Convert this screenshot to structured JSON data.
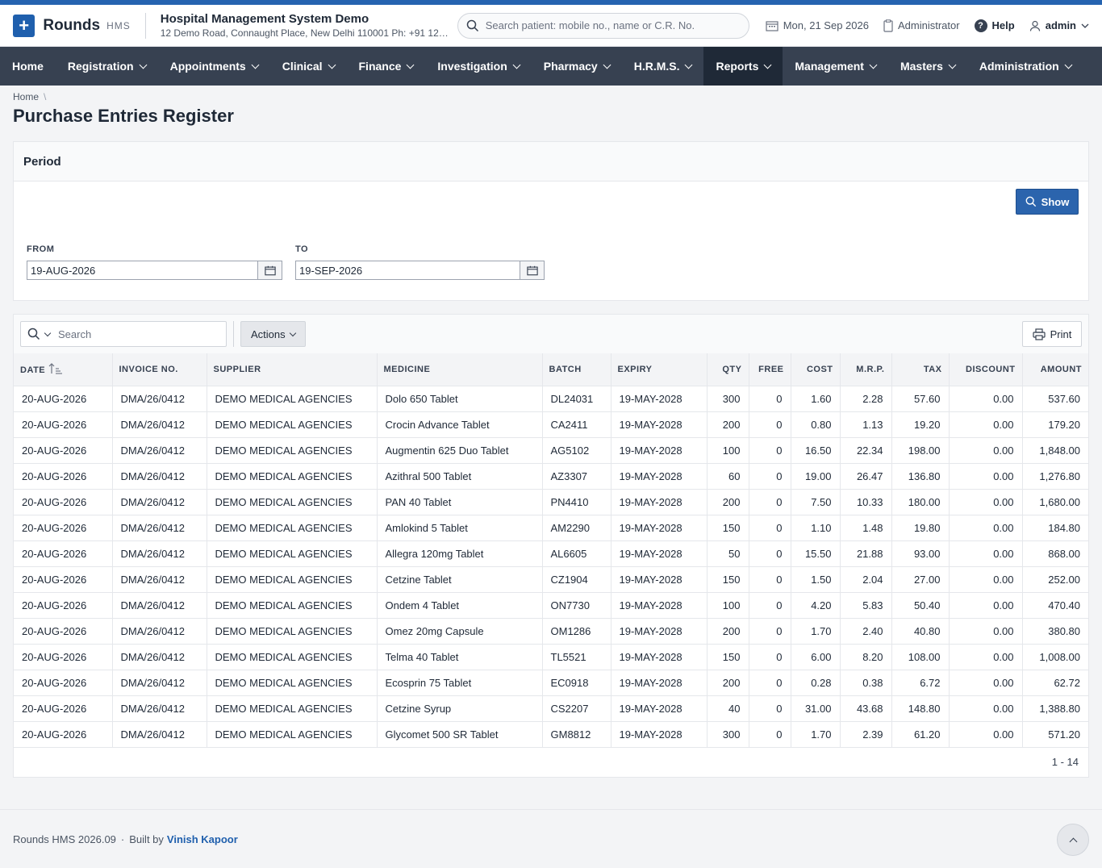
{
  "header": {
    "brand": "Rounds",
    "brand_sub": "HMS",
    "org_title": "Hospital Management System Demo",
    "org_address": "12 Demo Road, Connaught Place, New Delhi 110001 Ph: +91 123...",
    "search_placeholder": "Search patient: mobile no., name or C.R. No.",
    "date": "Mon, 21 Sep 2026",
    "role": "Administrator",
    "help": "Help",
    "user": "admin"
  },
  "nav": [
    {
      "label": "Home",
      "dropdown": false
    },
    {
      "label": "Registration",
      "dropdown": true
    },
    {
      "label": "Appointments",
      "dropdown": true
    },
    {
      "label": "Clinical",
      "dropdown": true
    },
    {
      "label": "Finance",
      "dropdown": true
    },
    {
      "label": "Investigation",
      "dropdown": true
    },
    {
      "label": "Pharmacy",
      "dropdown": true
    },
    {
      "label": "H.R.M.S.",
      "dropdown": true
    },
    {
      "label": "Reports",
      "dropdown": true,
      "active": true
    },
    {
      "label": "Management",
      "dropdown": true
    },
    {
      "label": "Masters",
      "dropdown": true
    },
    {
      "label": "Administration",
      "dropdown": true
    }
  ],
  "breadcrumb": {
    "home": "Home",
    "sep": "\\"
  },
  "page_title": "Purchase Entries Register",
  "period": {
    "title": "Period",
    "show_label": "Show",
    "from_label": "FROM",
    "from_value": "19-AUG-2026",
    "to_label": "TO",
    "to_value": "19-SEP-2026"
  },
  "toolbar": {
    "search_placeholder": "Search",
    "actions_label": "Actions",
    "print_label": "Print"
  },
  "table": {
    "columns": [
      {
        "label": "DATE",
        "num": false
      },
      {
        "label": "INVOICE NO.",
        "num": false
      },
      {
        "label": "SUPPLIER",
        "num": false
      },
      {
        "label": "MEDICINE",
        "num": false
      },
      {
        "label": "BATCH",
        "num": false
      },
      {
        "label": "EXPIRY",
        "num": false
      },
      {
        "label": "QTY",
        "num": true
      },
      {
        "label": "FREE",
        "num": true
      },
      {
        "label": "COST",
        "num": true
      },
      {
        "label": "M.R.P.",
        "num": true
      },
      {
        "label": "TAX",
        "num": true
      },
      {
        "label": "DISCOUNT",
        "num": true
      },
      {
        "label": "AMOUNT",
        "num": true
      }
    ],
    "rows": [
      [
        "20-AUG-2026",
        "DMA/26/0412",
        "DEMO MEDICAL AGENCIES",
        "Dolo 650 Tablet",
        "DL24031",
        "19-MAY-2028",
        "300",
        "0",
        "1.60",
        "2.28",
        "57.60",
        "0.00",
        "537.60"
      ],
      [
        "20-AUG-2026",
        "DMA/26/0412",
        "DEMO MEDICAL AGENCIES",
        "Crocin Advance Tablet",
        "CA2411",
        "19-MAY-2028",
        "200",
        "0",
        "0.80",
        "1.13",
        "19.20",
        "0.00",
        "179.20"
      ],
      [
        "20-AUG-2026",
        "DMA/26/0412",
        "DEMO MEDICAL AGENCIES",
        "Augmentin 625 Duo Tablet",
        "AG5102",
        "19-MAY-2028",
        "100",
        "0",
        "16.50",
        "22.34",
        "198.00",
        "0.00",
        "1,848.00"
      ],
      [
        "20-AUG-2026",
        "DMA/26/0412",
        "DEMO MEDICAL AGENCIES",
        "Azithral 500 Tablet",
        "AZ3307",
        "19-MAY-2028",
        "60",
        "0",
        "19.00",
        "26.47",
        "136.80",
        "0.00",
        "1,276.80"
      ],
      [
        "20-AUG-2026",
        "DMA/26/0412",
        "DEMO MEDICAL AGENCIES",
        "PAN 40 Tablet",
        "PN4410",
        "19-MAY-2028",
        "200",
        "0",
        "7.50",
        "10.33",
        "180.00",
        "0.00",
        "1,680.00"
      ],
      [
        "20-AUG-2026",
        "DMA/26/0412",
        "DEMO MEDICAL AGENCIES",
        "Amlokind 5 Tablet",
        "AM2290",
        "19-MAY-2028",
        "150",
        "0",
        "1.10",
        "1.48",
        "19.80",
        "0.00",
        "184.80"
      ],
      [
        "20-AUG-2026",
        "DMA/26/0412",
        "DEMO MEDICAL AGENCIES",
        "Allegra 120mg Tablet",
        "AL6605",
        "19-MAY-2028",
        "50",
        "0",
        "15.50",
        "21.88",
        "93.00",
        "0.00",
        "868.00"
      ],
      [
        "20-AUG-2026",
        "DMA/26/0412",
        "DEMO MEDICAL AGENCIES",
        "Cetzine Tablet",
        "CZ1904",
        "19-MAY-2028",
        "150",
        "0",
        "1.50",
        "2.04",
        "27.00",
        "0.00",
        "252.00"
      ],
      [
        "20-AUG-2026",
        "DMA/26/0412",
        "DEMO MEDICAL AGENCIES",
        "Ondem 4 Tablet",
        "ON7730",
        "19-MAY-2028",
        "100",
        "0",
        "4.20",
        "5.83",
        "50.40",
        "0.00",
        "470.40"
      ],
      [
        "20-AUG-2026",
        "DMA/26/0412",
        "DEMO MEDICAL AGENCIES",
        "Omez 20mg Capsule",
        "OM1286",
        "19-MAY-2028",
        "200",
        "0",
        "1.70",
        "2.40",
        "40.80",
        "0.00",
        "380.80"
      ],
      [
        "20-AUG-2026",
        "DMA/26/0412",
        "DEMO MEDICAL AGENCIES",
        "Telma 40 Tablet",
        "TL5521",
        "19-MAY-2028",
        "150",
        "0",
        "6.00",
        "8.20",
        "108.00",
        "0.00",
        "1,008.00"
      ],
      [
        "20-AUG-2026",
        "DMA/26/0412",
        "DEMO MEDICAL AGENCIES",
        "Ecosprin 75 Tablet",
        "EC0918",
        "19-MAY-2028",
        "200",
        "0",
        "0.28",
        "0.38",
        "6.72",
        "0.00",
        "62.72"
      ],
      [
        "20-AUG-2026",
        "DMA/26/0412",
        "DEMO MEDICAL AGENCIES",
        "Cetzine Syrup",
        "CS2207",
        "19-MAY-2028",
        "40",
        "0",
        "31.00",
        "43.68",
        "148.80",
        "0.00",
        "1,388.80"
      ],
      [
        "20-AUG-2026",
        "DMA/26/0412",
        "DEMO MEDICAL AGENCIES",
        "Glycomet 500 SR Tablet",
        "GM8812",
        "19-MAY-2028",
        "300",
        "0",
        "1.70",
        "2.39",
        "61.20",
        "0.00",
        "571.20"
      ]
    ],
    "pager": "1 - 14"
  },
  "footer": {
    "version": "Rounds HMS 2026.09",
    "dot": "·",
    "built_by": "Built by",
    "author": "Vinish Kapoor"
  },
  "colors": {
    "accent": "#2b64ad",
    "nav_bg": "#374151",
    "nav_active": "#1f2937"
  },
  "icons": [
    "plus-icon",
    "search-icon",
    "calendar-icon",
    "clipboard-icon",
    "help-icon",
    "user-icon",
    "chevron-down-icon",
    "sort-asc-icon",
    "printer-icon",
    "chevron-up-icon"
  ]
}
